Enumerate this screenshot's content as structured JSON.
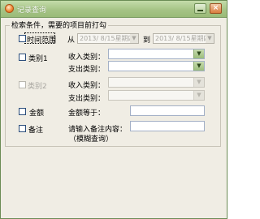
{
  "window": {
    "title": "记录查询"
  },
  "group": {
    "title": "检索条件，需要的项目前打勾"
  },
  "rows": {
    "time": {
      "label": "时间范围",
      "from_label": "从",
      "from_value": "2013/ 8/15星期四",
      "to_label": "到",
      "to_value": "2013/ 8/15星期四"
    },
    "category1": {
      "label": "类别1",
      "income_label": "收入类别：",
      "expense_label": "支出类别："
    },
    "category2": {
      "label": "类别2",
      "income_label": "收入类别：",
      "expense_label": "支出类别："
    },
    "amount": {
      "label": "金额",
      "equal_label": "金额等于："
    },
    "note": {
      "label": "备注",
      "prompt_label": "请输入备注内容：",
      "fuzzy_label": "（模糊查询）"
    }
  }
}
